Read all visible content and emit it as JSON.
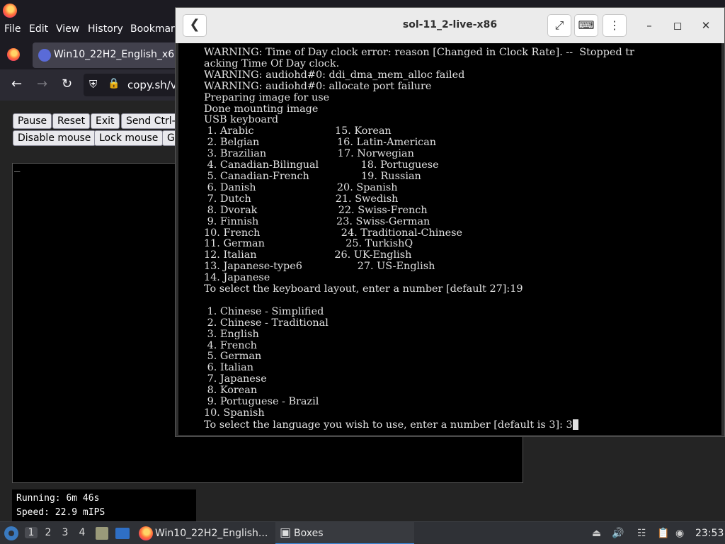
{
  "firefox": {
    "menu": [
      "File",
      "Edit",
      "View",
      "History",
      "Bookmark"
    ],
    "tab_title": "Win10_22H2_English_x6",
    "url": "copy.sh/v",
    "controls_row1": [
      "Pause",
      "Reset",
      "Exit",
      "Send Ctrl-A"
    ],
    "controls_row2": [
      "Disable mouse",
      "Lock mouse",
      "G"
    ],
    "emulator_cursor": "_",
    "status": {
      "running": "Running: 6m 46s",
      "speed": "Speed: 22.9 mIPS"
    }
  },
  "boxes": {
    "title": "sol-11_2-live-x86",
    "back_icon": "chevron-left-icon",
    "terminal_lines": [
      "WARNING: Time of Day clock error: reason [Changed in Clock Rate]. --  Stopped tr",
      "acking Time Of Day clock.",
      "WARNING: audiohd#0: ddi_dma_mem_alloc failed",
      "WARNING: audiohd#0: allocate port failure",
      "Preparing image for use",
      "Done mounting image",
      "USB keyboard",
      " 1. Arabic                         15. Korean",
      " 2. Belgian                        16. Latin-American",
      " 3. Brazilian                      17. Norwegian",
      " 4. Canadian-Bilingual             18. Portuguese",
      " 5. Canadian-French                19. Russian",
      " 6. Danish                         20. Spanish",
      " 7. Dutch                          21. Swedish",
      " 8. Dvorak                         22. Swiss-French",
      " 9. Finnish                        23. Swiss-German",
      "10. French                         24. Traditional-Chinese",
      "11. German                         25. TurkishQ",
      "12. Italian                        26. UK-English",
      "13. Japanese-type6                 27. US-English",
      "14. Japanese",
      "To select the keyboard layout, enter a number [default 27]:19",
      "",
      " 1. Chinese - Simplified",
      " 2. Chinese - Traditional",
      " 3. English",
      " 4. French",
      " 5. German",
      " 6. Italian",
      " 7. Japanese",
      " 8. Korean",
      " 9. Portuguese - Brazil",
      "10. Spanish"
    ],
    "prompt_line": "To select the language you wish to use, enter a number [default is 3]: 3"
  },
  "taskbar": {
    "workspaces": [
      "1",
      "2",
      "3",
      "4"
    ],
    "tasks": [
      "Win10_22H2_English...",
      "Boxes"
    ],
    "clock": "23:53"
  },
  "colors": {
    "firefox_dark": "#1c1b22",
    "firefox_toolbar": "#2b2a33",
    "boxes_header": "#ebebeb",
    "terminal_bg": "#000000",
    "taskbar_bg": "#2f3136",
    "taskbar_active_accent": "#3b8fe8"
  }
}
